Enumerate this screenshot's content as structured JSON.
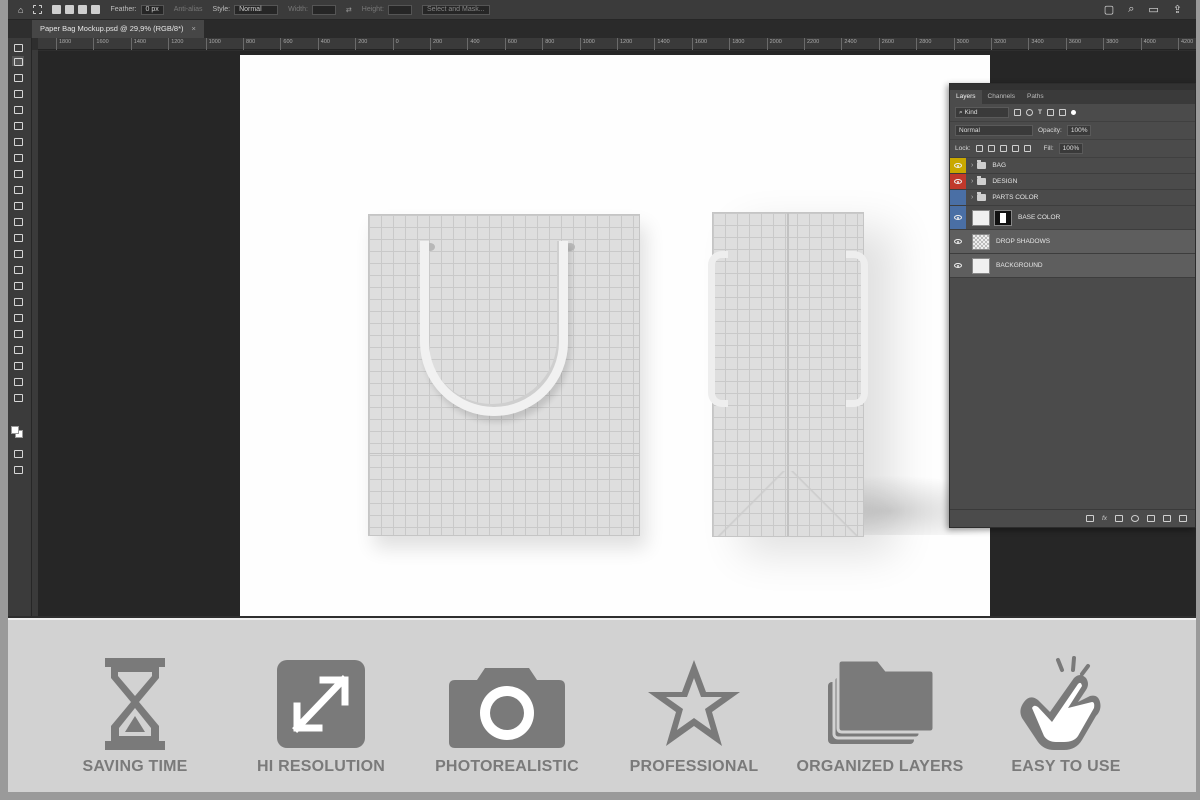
{
  "options_bar": {
    "feather_label": "Feather:",
    "feather_value": "0 px",
    "anti_alias_label": "Anti-alias",
    "style_label": "Style:",
    "style_value": "Normal",
    "width_label": "Width:",
    "height_label": "Height:",
    "select_mask_label": "Select and Mask..."
  },
  "document_tab": {
    "title": "Paper Bag Mockup.psd @ 29,9% (RGB/8*)",
    "close": "×"
  },
  "ruler_ticks": [
    "1800",
    "1600",
    "1400",
    "1200",
    "1000",
    "800",
    "600",
    "400",
    "200",
    "0",
    "200",
    "400",
    "600",
    "800",
    "1000",
    "1200",
    "1400",
    "1600",
    "1800",
    "2000",
    "2200",
    "2400",
    "2600",
    "2800",
    "3000",
    "3200",
    "3400",
    "3600",
    "3800",
    "4000",
    "4200",
    "4400",
    "4600"
  ],
  "layers_panel": {
    "tabs": [
      {
        "label": "Layers",
        "active": true
      },
      {
        "label": "Channels",
        "active": false
      },
      {
        "label": "Paths",
        "active": false
      }
    ],
    "filter_label": "Kind",
    "blend_mode": "Normal",
    "opacity_label": "Opacity:",
    "opacity_value": "100%",
    "lock_label": "Lock:",
    "fill_label": "Fill:",
    "fill_value": "100%",
    "layers": [
      {
        "name": "BAG",
        "type": "group",
        "eye_color": "#c9a800"
      },
      {
        "name": "DESIGN",
        "type": "group",
        "eye_color": "#c0392b"
      },
      {
        "name": "PARTS COLOR",
        "type": "group",
        "eye_color": "#4a6fa5"
      },
      {
        "name": "BASE COLOR",
        "type": "masked",
        "eye_color": "#4a6fa5"
      },
      {
        "name": "DROP SHADOWS",
        "type": "layer",
        "eye_color": ""
      },
      {
        "name": "BACKGROUND",
        "type": "layer",
        "eye_color": ""
      }
    ]
  },
  "features": [
    {
      "label": "SAVING TIME",
      "icon": "hourglass-icon"
    },
    {
      "label": "HI RESOLUTION",
      "icon": "expand-arrows-icon"
    },
    {
      "label": "PHOTOREALISTIC",
      "icon": "camera-icon"
    },
    {
      "label": "PROFESSIONAL",
      "icon": "star-icon"
    },
    {
      "label": "ORGANIZED LAYERS",
      "icon": "layers-folder-icon"
    },
    {
      "label": "EASY TO USE",
      "icon": "tap-hand-icon"
    }
  ],
  "colors": {
    "icon_gray": "#7a7a7a",
    "strip_bg": "#d2d2d2",
    "panel_bg": "#4b4b4b"
  }
}
